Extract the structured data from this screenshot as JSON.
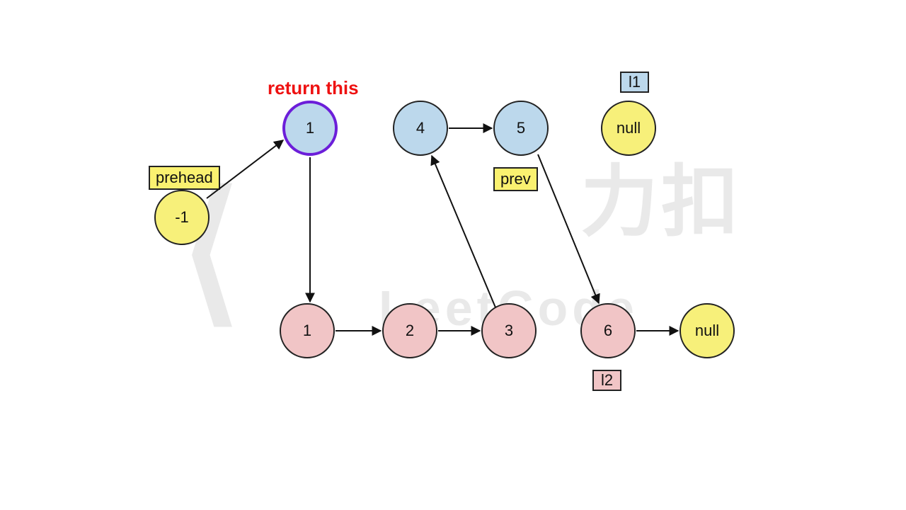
{
  "notes": {
    "return_this": "return this"
  },
  "labels": {
    "prehead": "prehead",
    "prev": "prev",
    "l1": "l1",
    "l2": "l2"
  },
  "nodes": {
    "prehead": "-1",
    "blue1": "1",
    "blue4": "4",
    "blue5": "5",
    "null_top": "null",
    "pink1": "1",
    "pink2": "2",
    "pink3": "3",
    "pink6": "6",
    "null_bot": "null"
  },
  "colors": {
    "blue_fill": "#bcd8ec",
    "pink_fill": "#f1c5c6",
    "yellow_fill": "#f7f07a",
    "purple_border": "#6c1ed9",
    "note_red": "#ee1111",
    "arrow": "#111111"
  },
  "diagram": {
    "description": "Linked-list merge step diagram: prehead (-1) points to highlighted node 1 (return value). Node 1 (blue, l1 list) then points into pink list 1→2→3; node 3 points back up to blue 4→5 (prev at 5); 5 points down to pink 6→null. Pointer l1 sits at top-right null; pointer l2 under pink 6.",
    "edges": [
      [
        "prehead",
        "blue1"
      ],
      [
        "blue1",
        "pink1"
      ],
      [
        "pink1",
        "pink2"
      ],
      [
        "pink2",
        "pink3"
      ],
      [
        "pink3",
        "blue4"
      ],
      [
        "blue4",
        "blue5"
      ],
      [
        "blue5",
        "pink6"
      ],
      [
        "pink6",
        "null_bot"
      ]
    ]
  }
}
